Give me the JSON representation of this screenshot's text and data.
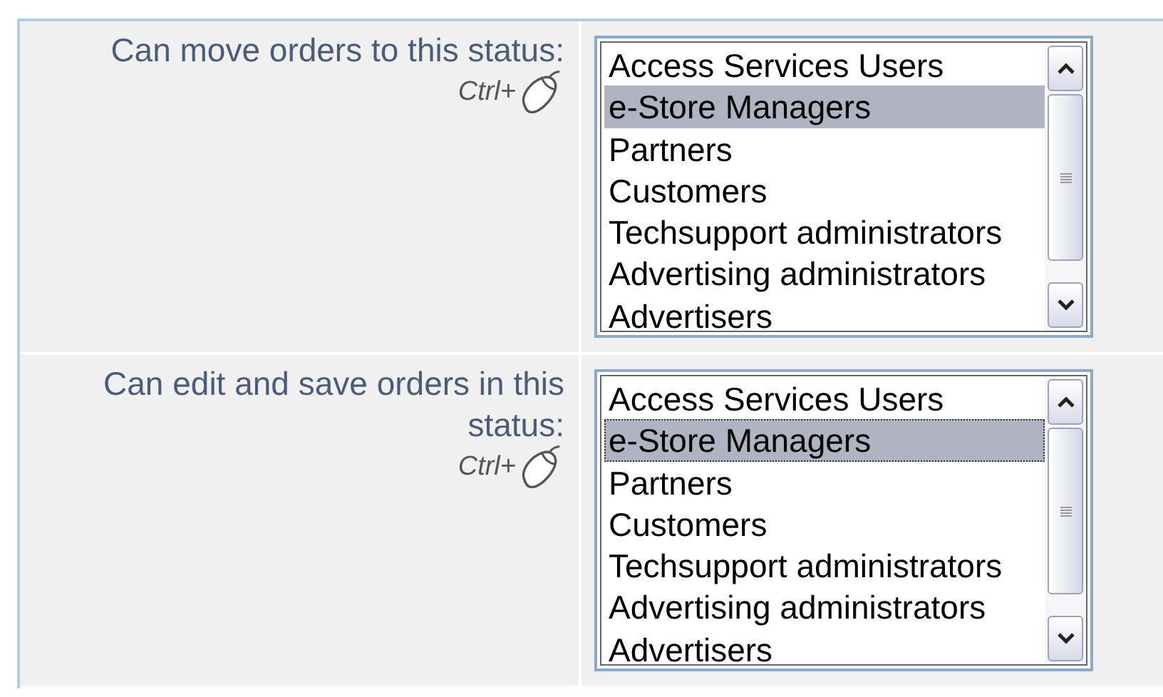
{
  "rows": [
    {
      "label": "Can move orders to this status:",
      "hint": "Ctrl+",
      "list": {
        "focused": false,
        "items": [
          {
            "label": "Access Services Users",
            "selected": false
          },
          {
            "label": "e-Store Managers",
            "selected": true
          },
          {
            "label": "Partners",
            "selected": false
          },
          {
            "label": "Customers",
            "selected": false
          },
          {
            "label": "Techsupport administrators",
            "selected": false
          },
          {
            "label": "Advertising administrators",
            "selected": false
          },
          {
            "label": "Advertisers",
            "selected": false
          }
        ]
      }
    },
    {
      "label": "Can edit and save orders in this status:",
      "hint": "Ctrl+",
      "list": {
        "focused": true,
        "items": [
          {
            "label": "Access Services Users",
            "selected": false
          },
          {
            "label": "e-Store Managers",
            "selected": true
          },
          {
            "label": "Partners",
            "selected": false
          },
          {
            "label": "Customers",
            "selected": false
          },
          {
            "label": "Techsupport administrators",
            "selected": false
          },
          {
            "label": "Advertising administrators",
            "selected": false
          },
          {
            "label": "Advertisers",
            "selected": false
          }
        ]
      }
    }
  ]
}
